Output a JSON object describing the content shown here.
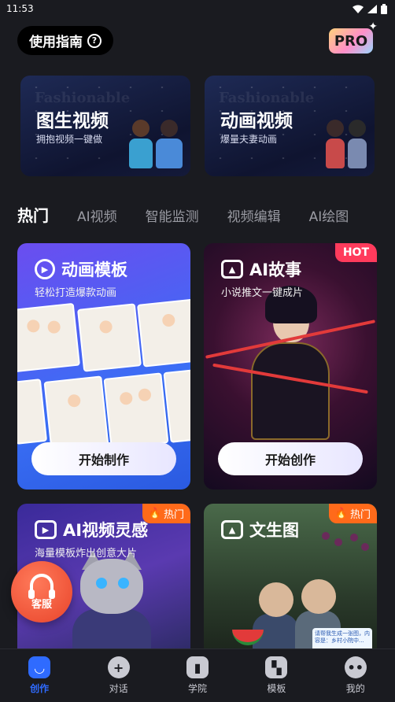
{
  "status_bar": {
    "time": "11:53"
  },
  "header": {
    "guide_label": "使用指南",
    "help_glyph": "?",
    "pro_label": "PRO"
  },
  "banners": [
    {
      "watermark": "Fashionable",
      "title": "图生视频",
      "subtitle": "拥抱视频一键做"
    },
    {
      "watermark": "Fashionable",
      "title": "动画视频",
      "subtitle": "爆量夫妻动画"
    }
  ],
  "tabs": [
    {
      "label": "热门",
      "active": true
    },
    {
      "label": "AI视频",
      "active": false
    },
    {
      "label": "智能监测",
      "active": false
    },
    {
      "label": "视频编辑",
      "active": false
    },
    {
      "label": "AI绘图",
      "active": false
    }
  ],
  "cards": {
    "animation": {
      "title": "动画模板",
      "subtitle": "轻松打造爆款动画",
      "cta": "开始制作"
    },
    "story": {
      "title": "AI故事",
      "subtitle": "小说推文一键成片",
      "cta": "开始创作",
      "badge": "HOT"
    },
    "video": {
      "title": "AI视频灵感",
      "subtitle": "海量模板炸出创意大片",
      "badge": "热门"
    },
    "text2img": {
      "title": "文生图",
      "badge": "热门",
      "note": "请帮我生成一张图，内容是：乡村小院中..."
    }
  },
  "service": {
    "label": "客服"
  },
  "bottom_nav": [
    {
      "label": "创作",
      "icon": "create-icon",
      "active": true
    },
    {
      "label": "对话",
      "icon": "chat-icon",
      "active": false
    },
    {
      "label": "学院",
      "icon": "academy-icon",
      "active": false
    },
    {
      "label": "模板",
      "icon": "template-icon",
      "active": false
    },
    {
      "label": "我的",
      "icon": "profile-icon",
      "active": false
    }
  ],
  "colors": {
    "accent": "#2f6bff",
    "hot": "#ff3b5c",
    "fire": "#ff6a1a",
    "service": "#e8442a"
  }
}
